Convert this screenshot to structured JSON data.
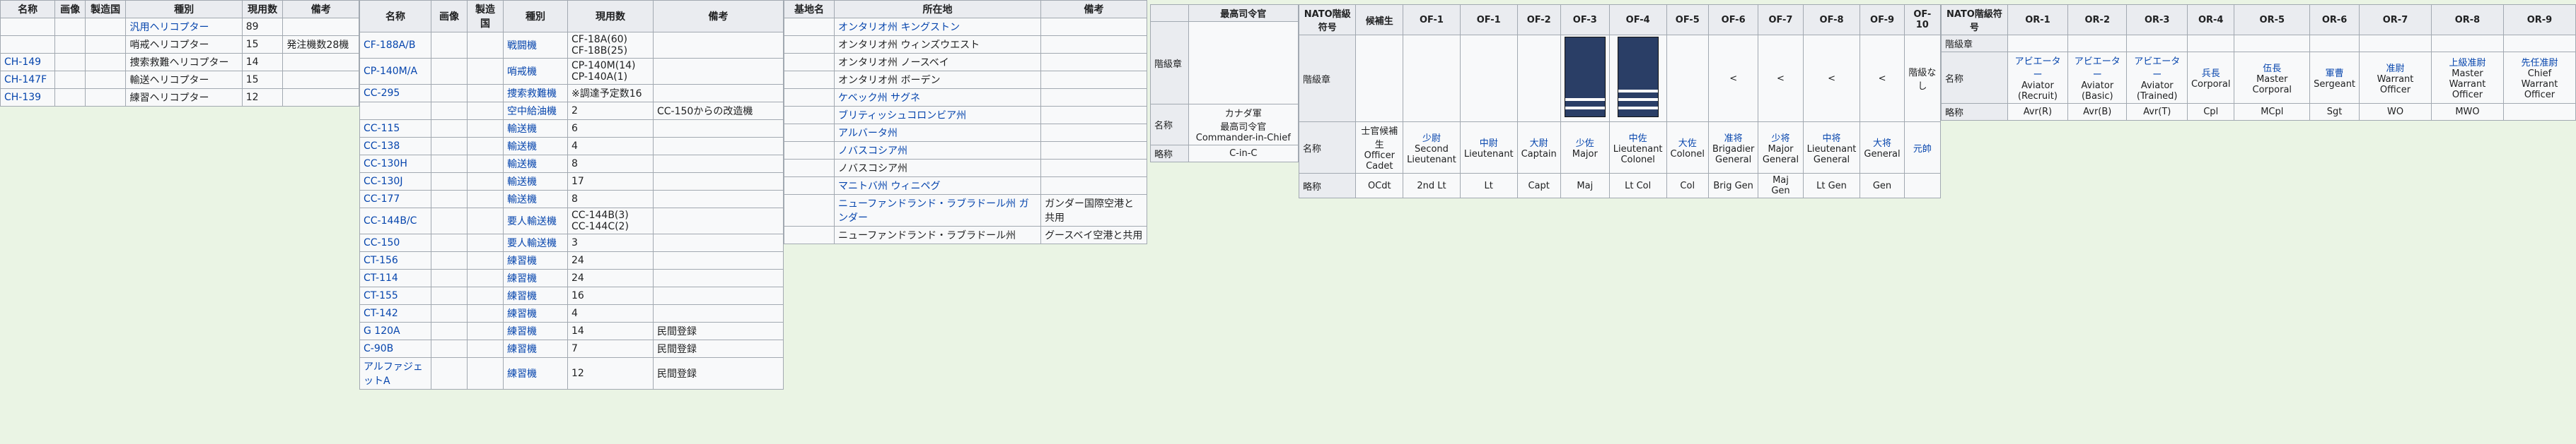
{
  "table1": {
    "headers": [
      "名称",
      "画像",
      "製造国",
      "種別",
      "現用数",
      "備考"
    ],
    "rows": [
      {
        "name": "",
        "type": "汎用ヘリコプター",
        "count": "89",
        "note": "",
        "link": true,
        "typelink": true
      },
      {
        "name": "",
        "type": "哨戒ヘリコプター",
        "count": "15",
        "note": "発注機数28機",
        "link": false,
        "typelink": false
      },
      {
        "name": "CH-149",
        "type": "捜索救難ヘリコプター",
        "count": "14",
        "note": "",
        "link": true,
        "typelink": false
      },
      {
        "name": "CH-147F",
        "type": "輸送ヘリコプター",
        "count": "15",
        "note": "",
        "link": true,
        "typelink": false
      },
      {
        "name": "CH-139",
        "type": "練習ヘリコプター",
        "count": "12",
        "note": "",
        "link": true,
        "typelink": false
      }
    ]
  },
  "table2": {
    "headers": [
      "名称",
      "画像",
      "製造国",
      "種別",
      "現用数",
      "備考"
    ],
    "rows": [
      {
        "name": "CF-188A/B",
        "type": "戦闘機",
        "count": "CF-18A(60)\nCF-18B(25)",
        "note": ""
      },
      {
        "name": "CP-140M/A",
        "type": "哨戒機",
        "count": "CP-140M(14)\nCP-140A(1)",
        "note": ""
      },
      {
        "name": "CC-295",
        "type": "捜索救難機",
        "count": "※調達予定数16",
        "note": ""
      },
      {
        "name": "",
        "type": "空中給油機",
        "count": "2",
        "note": "CC-150からの改造機"
      },
      {
        "name": "CC-115",
        "type": "輸送機",
        "count": "6",
        "note": ""
      },
      {
        "name": "CC-138",
        "type": "輸送機",
        "count": "4",
        "note": ""
      },
      {
        "name": "CC-130H",
        "type": "輸送機",
        "count": "8",
        "note": ""
      },
      {
        "name": "CC-130J",
        "type": "輸送機",
        "count": "17",
        "note": ""
      },
      {
        "name": "CC-177",
        "type": "輸送機",
        "count": "8",
        "note": ""
      },
      {
        "name": "CC-144B/C",
        "type": "要人輸送機",
        "count": "CC-144B(3)\nCC-144C(2)",
        "note": ""
      },
      {
        "name": "CC-150",
        "type": "要人輸送機",
        "count": "3",
        "note": ""
      },
      {
        "name": "CT-156",
        "type": "練習機",
        "count": "24",
        "note": ""
      },
      {
        "name": "CT-114",
        "type": "練習機",
        "count": "24",
        "note": ""
      },
      {
        "name": "CT-155",
        "type": "練習機",
        "count": "16",
        "note": ""
      },
      {
        "name": "CT-142",
        "type": "練習機",
        "count": "4",
        "note": ""
      },
      {
        "name": "G 120A",
        "type": "練習機",
        "count": "14",
        "note": "民間登録"
      },
      {
        "name": "C-90B",
        "type": "練習機",
        "count": "7",
        "note": "民間登録"
      },
      {
        "name": "アルファジェットA",
        "type": "練習機",
        "count": "12",
        "note": "民間登録"
      }
    ]
  },
  "table3": {
    "headers": [
      "基地名",
      "所在地",
      "備考"
    ],
    "rows": [
      {
        "loc": "オンタリオ州 キングストン",
        "note": "",
        "link": true
      },
      {
        "loc": "オンタリオ州 ウィンズウエスト",
        "note": "",
        "link": false
      },
      {
        "loc": "オンタリオ州 ノースベイ",
        "note": "",
        "link": false
      },
      {
        "loc": "オンタリオ州 ボーデン",
        "note": "",
        "link": false
      },
      {
        "loc": "ケベック州 サグネ",
        "note": "",
        "link": true
      },
      {
        "loc": "ブリティッシュコロンビア州",
        "note": "",
        "link": true
      },
      {
        "loc": "アルバータ州",
        "note": "",
        "link": true
      },
      {
        "loc": "ノバスコシア州",
        "note": "",
        "link": true
      },
      {
        "loc": "ノバスコシア州",
        "note": "",
        "link": false
      },
      {
        "loc": "マニトバ州 ウィニペグ",
        "note": "",
        "link": true
      },
      {
        "loc": "ニューファンドランド・ラブラドール州 ガンダー",
        "note": "ガンダー国際空港と共用",
        "link": true
      },
      {
        "loc": "ニューファンドランド・ラブラドール州",
        "note": "グースベイ空港と共用",
        "link": false
      }
    ]
  },
  "table4": {
    "header": "最高司令官",
    "row_labels": [
      "階級章",
      "名称",
      "略称"
    ],
    "name": "カナダ軍\n最高司令官\nCommander-in-Chief",
    "abbr": "C-in-C"
  },
  "table5": {
    "headers": [
      "NATO階級符号",
      "候補生",
      "OF-1",
      "OF-1",
      "OF-2",
      "OF-3",
      "OF-4",
      "OF-5",
      "OF-6",
      "OF-7",
      "OF-8",
      "OF-9",
      "OF-10"
    ],
    "row_labels": [
      "階級章",
      "名称",
      "略称"
    ],
    "insignia": [
      "",
      "",
      "",
      "",
      "有",
      "有",
      "",
      "<",
      "<",
      "<",
      "<",
      "階級なし"
    ],
    "names_jp": [
      "士官候補生",
      "少尉",
      "中尉",
      "大尉",
      "少佐",
      "中佐",
      "大佐",
      "准将",
      "少将",
      "中将",
      "大将",
      "元帥"
    ],
    "names_en": [
      "Officer\nCadet",
      "Second\nLieutenant",
      "Lieutenant",
      "Captain",
      "Major",
      "Lieutenant\nColonel",
      "Colonel",
      "Brigadier\nGeneral",
      "Major\nGeneral",
      "Lieutenant\nGeneral",
      "General",
      ""
    ],
    "abbr": [
      "OCdt",
      "2nd Lt",
      "Lt",
      "Capt",
      "Maj",
      "Lt Col",
      "Col",
      "Brig Gen",
      "Maj Gen",
      "Lt Gen",
      "Gen",
      ""
    ]
  },
  "table6": {
    "headers": [
      "NATO階級符号",
      "OR-1",
      "OR-2",
      "OR-3",
      "OR-4",
      "OR-5",
      "OR-6",
      "OR-7",
      "OR-8",
      "OR-9"
    ],
    "row_labels": [
      "階級章",
      "名称",
      "略称"
    ],
    "names_jp": [
      "アビエーター",
      "アビエーター",
      "アビエーター",
      "兵長",
      "伍長",
      "軍曹",
      "准尉",
      "上級准尉",
      "先任准尉"
    ],
    "names_en": [
      "Aviator\n(Recruit)",
      "Aviator\n(Basic)",
      "Aviator\n(Trained)",
      "Corporal",
      "Master Corporal",
      "Sergeant",
      "Warrant Officer",
      "Master\nWarrant Officer",
      "Chief\nWarrant Officer"
    ],
    "abbr": [
      "Avr(R)",
      "Avr(B)",
      "Avr(T)",
      "Cpl",
      "MCpl",
      "Sgt",
      "WO",
      "MWO",
      ""
    ]
  }
}
